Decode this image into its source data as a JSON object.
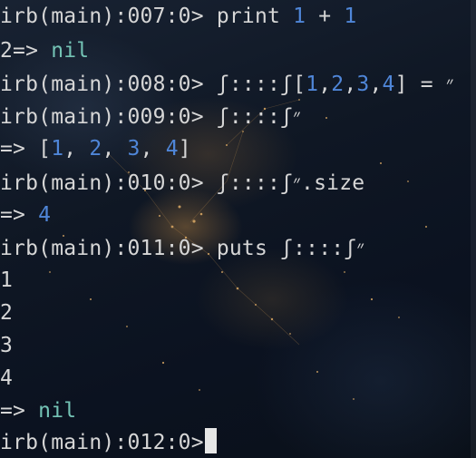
{
  "terminal": {
    "lines": [
      {
        "prompt": "irb(main):007:0> ",
        "code_a": "print ",
        "n1": "1",
        "op": " + ",
        "n2": "1"
      },
      {
        "out_a": "2=> ",
        "nil": "nil"
      },
      {
        "prompt": "irb(main):008:0> ",
        "var": "ʃ::::ʃ״",
        "eq": " = [",
        "v1": "1",
        "c1": ",",
        "v2": "2",
        "c2": ",",
        "v3": "3",
        "c3": ",",
        "v4": "4",
        "close": "]"
      },
      {
        "prompt": "irb(main):009:0> ",
        "var": "ʃ::::ʃ״"
      },
      {
        "arrow": "=> [",
        "v1": "1",
        "c1": ", ",
        "v2": "2",
        "c2": ", ",
        "v3": "3",
        "c3": ", ",
        "v4": "4",
        "close": "]"
      },
      {
        "prompt": "irb(main):010:0> ",
        "var": "ʃ::::ʃ״",
        "method": ".size"
      },
      {
        "arrow": "=> ",
        "value": "4"
      },
      {
        "prompt": "irb(main):011:0> ",
        "cmd": "puts ",
        "var": "ʃ::::ʃ״"
      },
      {
        "text": "1"
      },
      {
        "text": "2"
      },
      {
        "text": "3"
      },
      {
        "text": "4"
      },
      {
        "arrow": "=> ",
        "nil": "nil"
      },
      {
        "prompt": "irb(main):012:0>"
      }
    ]
  },
  "colors": {
    "text": "#d6d6d6",
    "number": "#4f86d8",
    "nil": "#74c3b5",
    "cursor": "#e6e6e6"
  }
}
